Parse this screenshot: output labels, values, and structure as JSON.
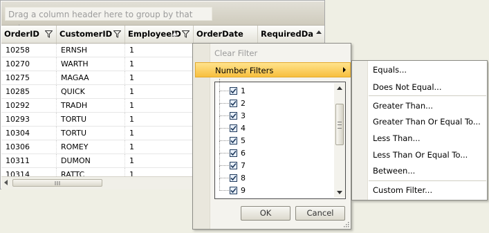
{
  "group_panel": {
    "hint": "Drag a column header here to group by that column."
  },
  "columns": [
    "OrderID",
    "CustomerID",
    "EmployeeID",
    "OrderDate",
    "RequiredDate"
  ],
  "rows": [
    {
      "order_id": "10258",
      "customer_id": "ERNSH",
      "employee_id": "1"
    },
    {
      "order_id": "10270",
      "customer_id": "WARTH",
      "employee_id": "1"
    },
    {
      "order_id": "10275",
      "customer_id": "MAGAA",
      "employee_id": "1"
    },
    {
      "order_id": "10285",
      "customer_id": "QUICK",
      "employee_id": "1"
    },
    {
      "order_id": "10292",
      "customer_id": "TRADH",
      "employee_id": "1"
    },
    {
      "order_id": "10293",
      "customer_id": "TORTU",
      "employee_id": "1"
    },
    {
      "order_id": "10304",
      "customer_id": "TORTU",
      "employee_id": "1"
    },
    {
      "order_id": "10306",
      "customer_id": "ROMEY",
      "employee_id": "1"
    },
    {
      "order_id": "10311",
      "customer_id": "DUMON",
      "employee_id": "1"
    },
    {
      "order_id": "10314",
      "customer_id": "RATTC",
      "employee_id": "1"
    }
  ],
  "filter_popup": {
    "clear_filter": "Clear Filter",
    "number_filters": "Number Filters",
    "values": [
      "1",
      "2",
      "3",
      "4",
      "5",
      "6",
      "7",
      "8",
      "9"
    ],
    "ok_label": "OK",
    "cancel_label": "Cancel"
  },
  "submenu": {
    "items": [
      "Equals...",
      "Does Not Equal...",
      "Greater Than...",
      "Greater Than Or Equal To...",
      "Less Than...",
      "Less Than Or Equal To...",
      "Between...",
      "Custom Filter..."
    ]
  },
  "colors": {
    "highlight": "#f7bf3e",
    "checkbox": "#1e395b"
  }
}
